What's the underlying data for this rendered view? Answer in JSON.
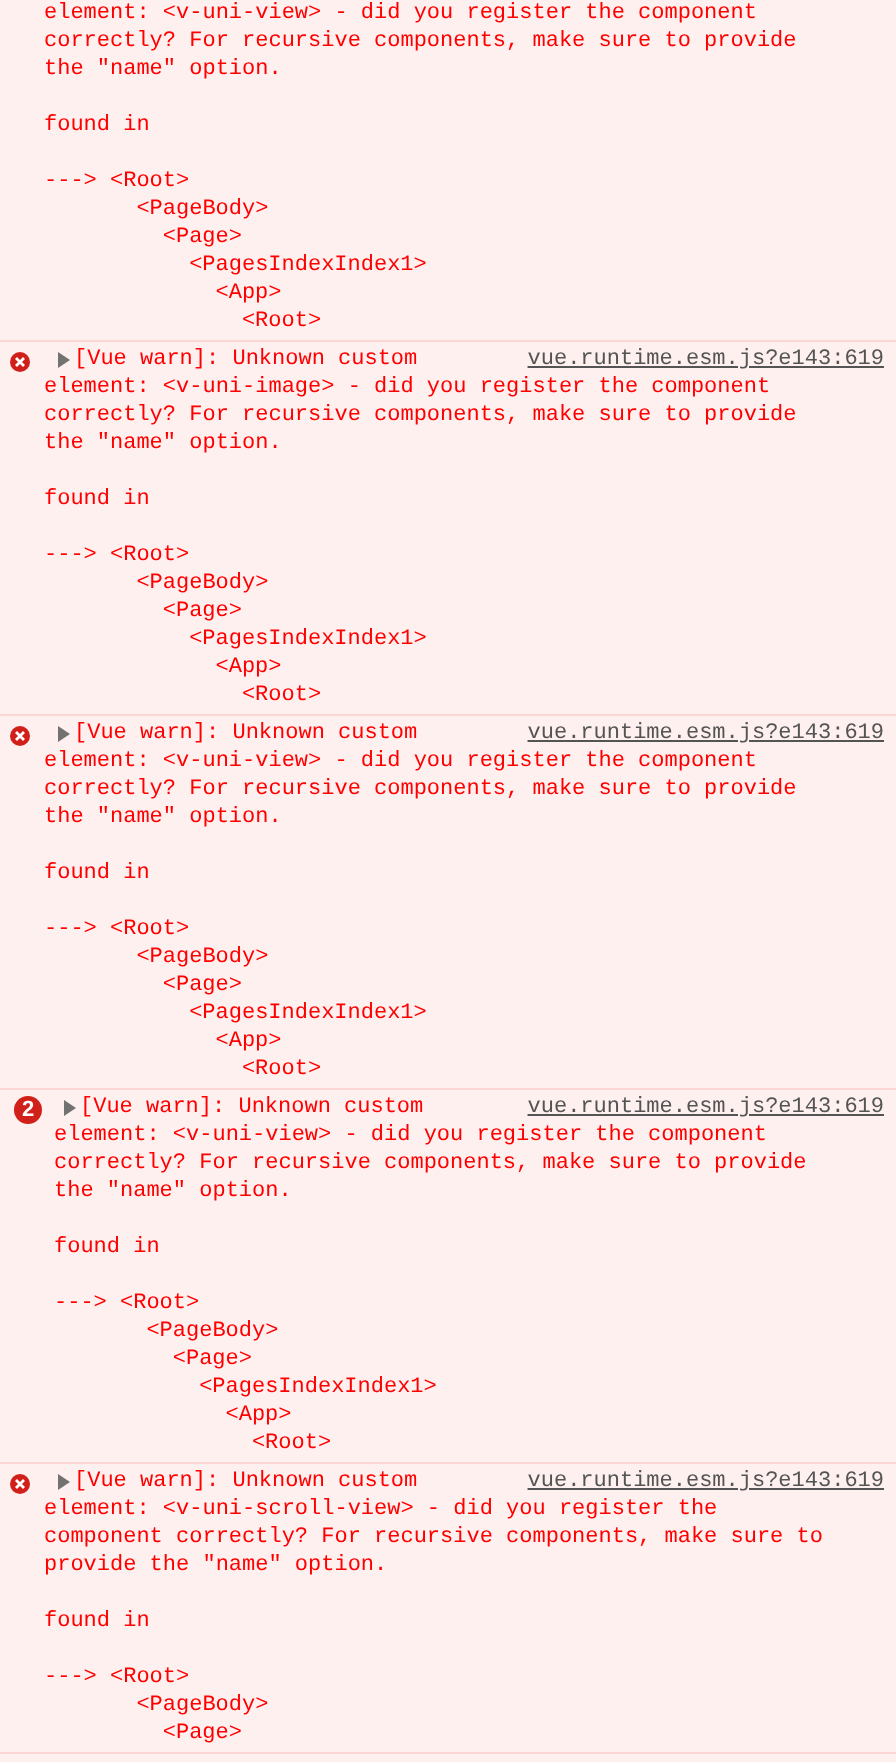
{
  "console": {
    "messages": [
      {
        "text": "element: <v-uni-view> - did you register the component\ncorrectly? For recursive components, make sure to provide\nthe \"name\" option.",
        "found": "found in",
        "arrow": "--->",
        "trace": [
          {
            "label": "<Root>",
            "children": [
              {
                "label": "<PageBody>",
                "children": [
                  {
                    "label": "<Page>",
                    "children": [
                      {
                        "label": "<PagesIndexIndex1>",
                        "children": [
                          {
                            "label": "<App>",
                            "children": [
                              {
                                "label": "<Root>"
                              }
                            ]
                          }
                        ]
                      }
                    ]
                  }
                ]
              }
            ]
          }
        ]
      },
      {
        "header": "[Vue warn]: Unknown custom",
        "source": "vue.runtime.esm.js?e143:619",
        "text": "element: <v-uni-image> - did you register the component\ncorrectly? For recursive components, make sure to provide\nthe \"name\" option.",
        "found": "found in",
        "arrow": "--->",
        "trace": [
          {
            "label": "<Root>",
            "children": [
              {
                "label": "<PageBody>",
                "children": [
                  {
                    "label": "<Page>",
                    "children": [
                      {
                        "label": "<PagesIndexIndex1>",
                        "children": [
                          {
                            "label": "<App>",
                            "children": [
                              {
                                "label": "<Root>"
                              }
                            ]
                          }
                        ]
                      }
                    ]
                  }
                ]
              }
            ]
          }
        ]
      },
      {
        "header": "[Vue warn]: Unknown custom",
        "source": "vue.runtime.esm.js?e143:619",
        "text": "element: <v-uni-view> - did you register the component\ncorrectly? For recursive components, make sure to provide\nthe \"name\" option.",
        "found": "found in",
        "arrow": "--->",
        "trace": [
          {
            "label": "<Root>",
            "children": [
              {
                "label": "<PageBody>",
                "children": [
                  {
                    "label": "<Page>",
                    "children": [
                      {
                        "label": "<PagesIndexIndex1>",
                        "children": [
                          {
                            "label": "<App>",
                            "children": [
                              {
                                "label": "<Root>"
                              }
                            ]
                          }
                        ]
                      }
                    ]
                  }
                ]
              }
            ]
          }
        ]
      },
      {
        "count": "2",
        "header": "[Vue warn]: Unknown custom",
        "source": "vue.runtime.esm.js?e143:619",
        "text": "element: <v-uni-view> - did you register the component\ncorrectly? For recursive components, make sure to provide\nthe \"name\" option.",
        "found": "found in",
        "arrow": "--->",
        "trace": [
          {
            "label": "<Root>",
            "children": [
              {
                "label": "<PageBody>",
                "children": [
                  {
                    "label": "<Page>",
                    "children": [
                      {
                        "label": "<PagesIndexIndex1>",
                        "children": [
                          {
                            "label": "<App>",
                            "children": [
                              {
                                "label": "<Root>"
                              }
                            ]
                          }
                        ]
                      }
                    ]
                  }
                ]
              }
            ]
          }
        ]
      },
      {
        "header": "[Vue warn]: Unknown custom",
        "source": "vue.runtime.esm.js?e143:619",
        "text": "element: <v-uni-scroll-view> - did you register the\ncomponent correctly? For recursive components, make sure to\nprovide the \"name\" option.",
        "found": "found in",
        "arrow": "--->",
        "trace": [
          {
            "label": "<Root>",
            "children": [
              {
                "label": "<PageBody>",
                "children": [
                  {
                    "label": "<Page>"
                  }
                ]
              }
            ]
          }
        ]
      }
    ]
  }
}
